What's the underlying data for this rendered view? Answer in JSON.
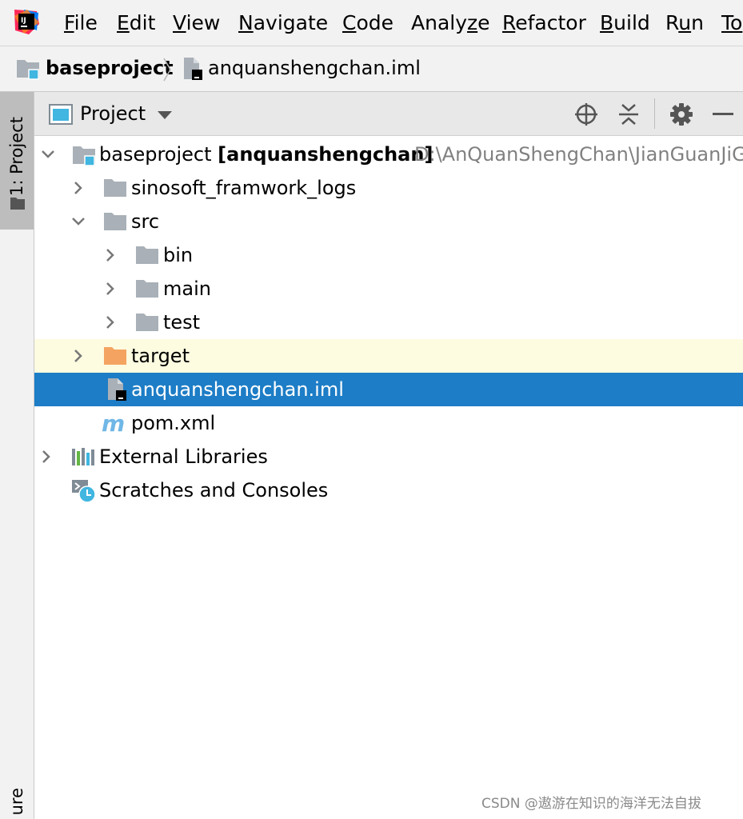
{
  "menu": {
    "items": [
      {
        "mn": "F",
        "rest": "ile"
      },
      {
        "mn": "E",
        "rest": "dit"
      },
      {
        "mn": "V",
        "rest": "iew"
      },
      {
        "mn": "N",
        "rest": "avigate"
      },
      {
        "mn": "C",
        "rest": "ode"
      },
      {
        "pre": "Analy",
        "mn": "z",
        "rest": "e"
      },
      {
        "mn": "R",
        "rest": "efactor"
      },
      {
        "mn": "B",
        "rest": "uild"
      },
      {
        "pre": "R",
        "mn": "u",
        "rest": "n"
      },
      {
        "pre": "To",
        "mn": "",
        "rest": ""
      }
    ]
  },
  "breadcrumb": {
    "project": "baseproject",
    "file": "anquanshengchan.iml"
  },
  "left_stripe": {
    "project_tab": "1: Project",
    "bottom_tab": "ure"
  },
  "tool_window": {
    "title": "Project"
  },
  "tree": {
    "root_name": "baseproject",
    "root_module": "[anquanshengchan]",
    "root_path": "D:\\AnQuanShengChan\\JianGuanJiG",
    "logs": "sinosoft_framwork_logs",
    "src": "src",
    "bin": "bin",
    "main": "main",
    "test": "test",
    "target": "target",
    "iml": "anquanshengchan.iml",
    "pom": "pom.xml",
    "libraries": "External Libraries",
    "scratches": "Scratches and Consoles"
  },
  "watermark": "CSDN @遨游在知识的海洋无法自拔",
  "colors": {
    "selection": "#1d7dc6",
    "target_highlight": "#fdfbe0",
    "folder_gray": "#a9b0b7",
    "excluded_folder": "#f4a460",
    "maven_blue": "#6fb7e6"
  }
}
